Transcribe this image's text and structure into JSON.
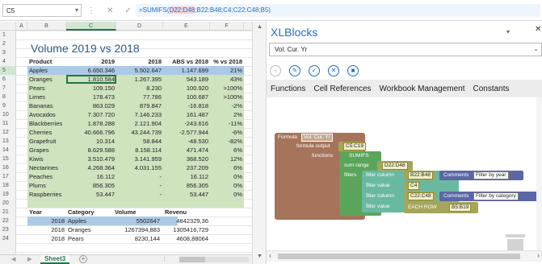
{
  "formula_bar": {
    "name_box": "C5",
    "cancel_icon": "✕",
    "enter_icon": "✓",
    "fx": "fx",
    "formula_prefix": "=SUMIFS(",
    "formula_highlight": "D22:D48",
    "formula_rest": ";B22:B48;C4;C22:C48;B5)"
  },
  "sheet": {
    "columns": [
      "A",
      "B",
      "C",
      "D",
      "E",
      "F"
    ],
    "rows": [
      "1",
      "2",
      "3",
      "4",
      "5",
      "6",
      "7",
      "8",
      "9",
      "10",
      "11",
      "12",
      "13",
      "14",
      "15",
      "16",
      "17",
      "18",
      "19",
      "20",
      "21",
      "22",
      "23",
      "24"
    ],
    "selected_row": "5",
    "selected_column": "C",
    "title": "Volume 2019 vs 2018",
    "table1": {
      "headers": [
        "Product",
        "2019",
        "2018",
        "ABS vs 2018",
        "% vs 2018"
      ],
      "rows": [
        [
          "Apples",
          "6.650.346",
          "5.502.647",
          "1.147.699",
          "21%"
        ],
        [
          "Oranges",
          "1.810.584",
          "1.267.395",
          "543.189",
          "43%"
        ],
        [
          "Pears",
          "109.150",
          "8.230",
          "100.920",
          ">100%"
        ],
        [
          "Limes",
          "178.473",
          "77.786",
          "100.687",
          ">100%"
        ],
        [
          "Bananas",
          "863.029",
          "879.847",
          "-16.818",
          "-2%"
        ],
        [
          "Avocados",
          "7.307.720",
          "7.146.233",
          "161.487",
          "2%"
        ],
        [
          "Blackberries",
          "1.878.288",
          "2.121.904",
          "-243.616",
          "-11%"
        ],
        [
          "Cherries",
          "40.666.796",
          "43.244.739",
          "-2.577.944",
          "-6%"
        ],
        [
          "Grapefruit",
          "10.314",
          "58.844",
          "-48.530",
          "-82%"
        ],
        [
          "Grapes",
          "8.629.588",
          "8.158.114",
          "471.474",
          "6%"
        ],
        [
          "Kiwis",
          "3.510.479",
          "3.141.959",
          "368.520",
          "12%"
        ],
        [
          "Nectarines",
          "4.268.364",
          "4.031.155",
          "237.209",
          "6%"
        ],
        [
          "Peaches",
          "16.112",
          "-",
          "16.112",
          "0%"
        ],
        [
          "Plums",
          "856.305",
          "-",
          "856.305",
          "0%"
        ],
        [
          "Raspberries",
          "53.447",
          "-",
          "53.447",
          "0%"
        ]
      ]
    },
    "table2": {
      "headers": [
        "Year",
        "Category",
        "Volume",
        "Revenu"
      ],
      "rows": [
        [
          "2018",
          "Apples",
          "5502647",
          "4842329,36"
        ],
        [
          "2018",
          "Oranges",
          "1267394,883",
          "1305416,729"
        ],
        [
          "2018",
          "Pears",
          "8230,144",
          "4608,88064"
        ]
      ]
    }
  },
  "tabs": {
    "prev_icon": "◀",
    "next_icon": "▶",
    "sheet_name": "Sheet3",
    "add_icon": "+",
    "more_icon": "⋮"
  },
  "pane": {
    "title": "XLBlocks",
    "collapse_icon": "▾",
    "close_icon": "✕",
    "selected_block": "Vol. Cur. Yr",
    "dropdown_icon": "⌄",
    "toolbar_icons": [
      "add-icon",
      "edit-icon",
      "check-icon",
      "cancel-icon",
      "stop-icon"
    ],
    "menu": [
      "Functions",
      "Cell References",
      "Workbook Management",
      "Constants"
    ],
    "blocks": {
      "formula_label": "Formula",
      "formula_name": "Vol. Cur. Yr",
      "formula_output_label": "formula output",
      "formula_output_value": "C5:C19",
      "functions_label": "functions",
      "sumifs_label": "SUMIFS",
      "sum_range_label": "sum range",
      "sum_range_value": "D22:D48",
      "filters_label": "filters",
      "filter_column_label_1": "filter column",
      "filter_column_value_1": "B22:B48",
      "filter_value_label_1": "filter value",
      "filter_value_value_1": "C4",
      "filter_column_label_2": "filter column",
      "filter_column_value_2": "C22:C48",
      "filter_value_label_2": "filter value",
      "each_row_label": "EACH ROW",
      "each_row_value": "B5:B19",
      "comment_label_1": "Comments",
      "comment_value_1": "Filter by year",
      "comment_label_2": "Comments",
      "comment_value_2": "Filter by category"
    },
    "colors": {
      "formula_block": "#a5745a",
      "functions_block": "#5ba55b",
      "filter_block": "#69b9a2",
      "filter_field_block": "#a5a55b",
      "comment_block": "#5b67a5"
    }
  }
}
